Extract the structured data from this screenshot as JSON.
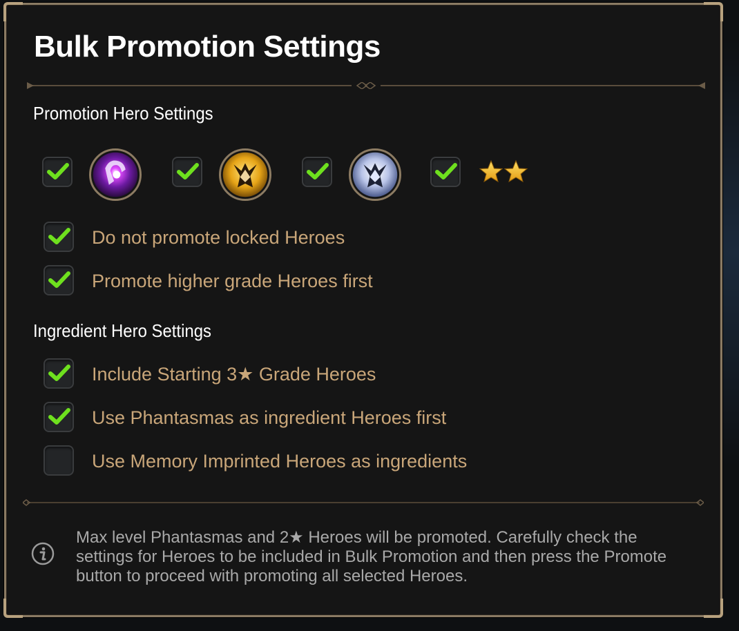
{
  "dialog": {
    "title": "Bulk Promotion Settings"
  },
  "promotion_section": {
    "header": "Promotion Hero Settings",
    "hero_filters": [
      {
        "icon": "dark-element-icon",
        "checked": true
      },
      {
        "icon": "light-element-icon",
        "checked": true
      },
      {
        "icon": "ice-element-icon",
        "checked": true
      },
      {
        "icon": "two-star-icon",
        "checked": true
      }
    ],
    "options": [
      {
        "label": "Do not promote locked Heroes",
        "checked": true
      },
      {
        "label": "Promote higher grade Heroes first",
        "checked": true
      }
    ]
  },
  "ingredient_section": {
    "header": "Ingredient Hero Settings",
    "options": [
      {
        "label": "Include Starting 3★ Grade Heroes",
        "checked": true
      },
      {
        "label": "Use Phantasmas as ingredient Heroes first",
        "checked": true
      },
      {
        "label": "Use Memory Imprinted Heroes as ingredients",
        "checked": false
      }
    ]
  },
  "info": {
    "icon": "info-icon",
    "text": "Max level Phantasmas and 2★ Heroes will be promoted. Carefully check the settings for Heroes to be included in Bulk Promotion and then press the Promote button to proceed with promoting all selected Heroes."
  },
  "colors": {
    "accent_check": "#6ee01e",
    "label_gold": "#c9a679",
    "frame_border": "#8a7a63"
  }
}
